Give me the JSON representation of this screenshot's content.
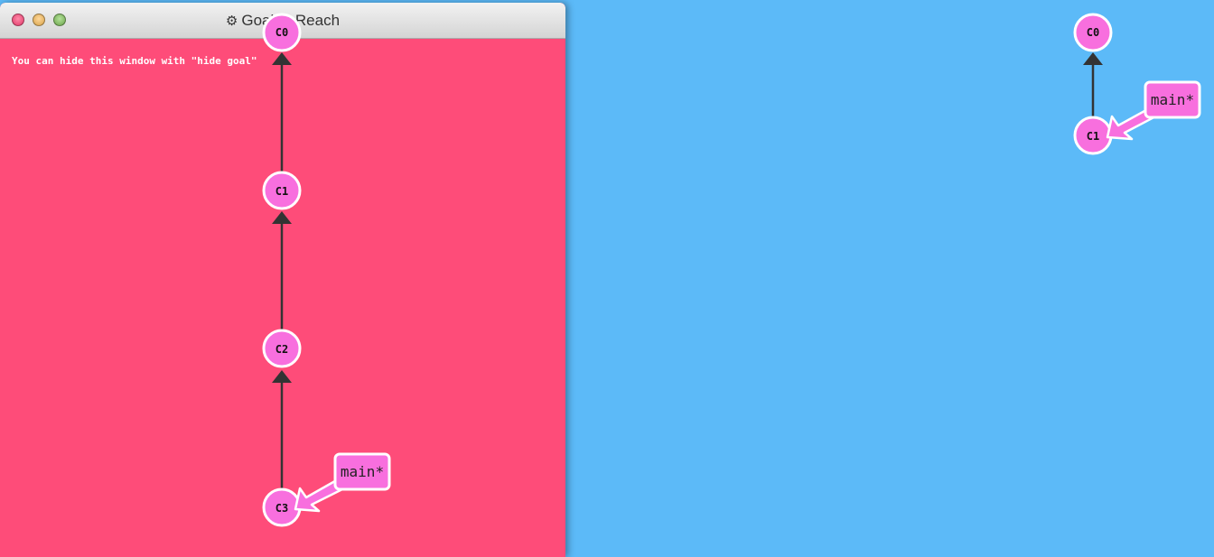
{
  "goal_window": {
    "title": "Goal to Reach",
    "gear_icon": "gear-icon",
    "hint": "You can hide this window with \"hide goal\"",
    "background_color": "#fe4c79",
    "commits": [
      {
        "id": "c0",
        "label": "C0"
      },
      {
        "id": "c1",
        "label": "C1"
      },
      {
        "id": "c2",
        "label": "C2"
      },
      {
        "id": "c3",
        "label": "C3"
      }
    ],
    "branch": {
      "label": "main*",
      "target": "C3"
    }
  },
  "current_tree": {
    "background_color": "#5cbaf8",
    "commits": [
      {
        "id": "c0",
        "label": "C0"
      },
      {
        "id": "c1",
        "label": "C1"
      }
    ],
    "branch": {
      "label": "main*",
      "target": "C1"
    }
  },
  "colors": {
    "commit_fill": "#f86fde",
    "commit_stroke": "#ffffff",
    "edge": "#333333"
  }
}
